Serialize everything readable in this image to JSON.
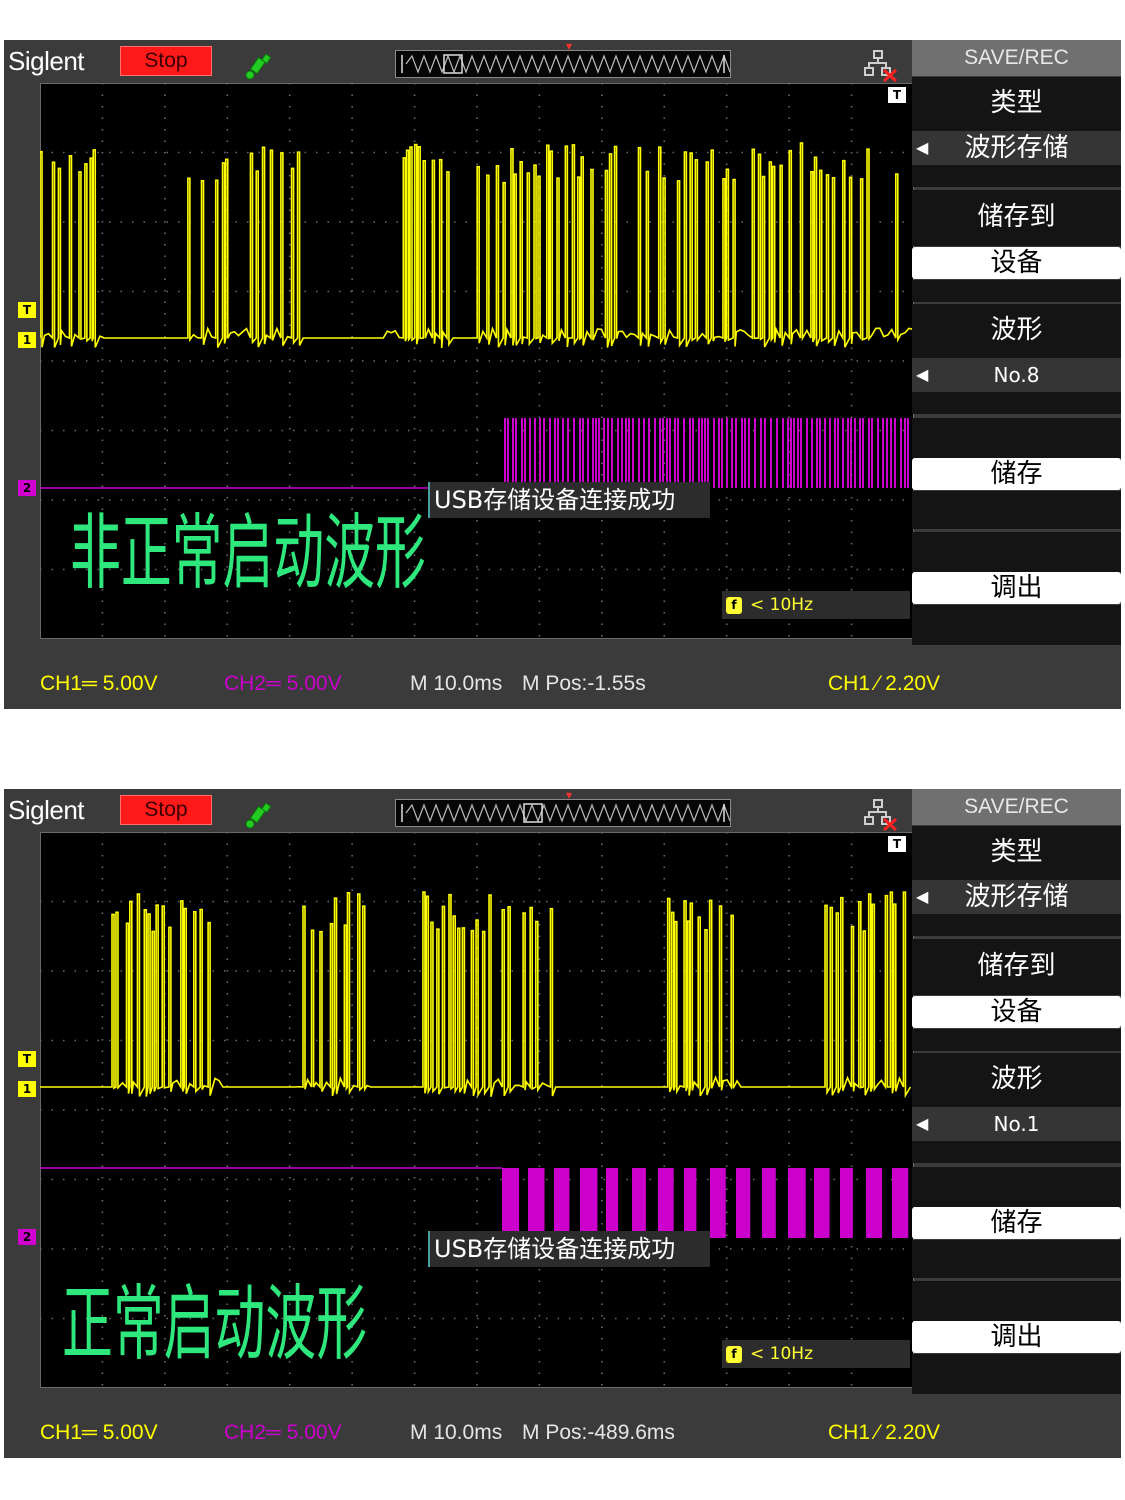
{
  "colors": {
    "ch1": "#ffff00",
    "ch2": "#cc00cc",
    "caption": "#2ee87e",
    "stop": "#ff1a1a"
  },
  "icons": [
    "usb-icon",
    "network-disconnected-icon",
    "trigger-marker-icon",
    "f-counter-icon"
  ],
  "screens": [
    {
      "brand": "Siglent",
      "run_state": "Stop",
      "trigger_mark": "T",
      "ch1_marker": "1",
      "ch2_marker": "2",
      "notice": "USB存储设备连接成功",
      "freq_badge": "f",
      "freq": "< 10Hz",
      "caption": "非正常启动波形",
      "status": {
        "ch1": "CH1═ 5.00V",
        "ch2": "CH2═ 5.00V",
        "timebase": "M 10.0ms",
        "mpos": "M Pos:-1.55s",
        "trigger": "CH1 ⁄ 2.20V"
      },
      "menu": {
        "title": "SAVE/REC",
        "type_label": "类型",
        "type_value": "波形存储",
        "save_to_label": "储存到",
        "save_to_value": "设备",
        "wave_label": "波形",
        "wave_value": "No.8",
        "save": "储存",
        "recall": "调出"
      }
    },
    {
      "brand": "Siglent",
      "run_state": "Stop",
      "trigger_mark": "T",
      "ch1_marker": "1",
      "ch2_marker": "2",
      "notice": "USB存储设备连接成功",
      "freq_badge": "f",
      "freq": "< 10Hz",
      "caption": "正常启动波形",
      "status": {
        "ch1": "CH1═ 5.00V",
        "ch2": "CH2═ 5.00V",
        "timebase": "M 10.0ms",
        "mpos": "M Pos:-489.6ms",
        "trigger": "CH1 ⁄ 2.20V"
      },
      "menu": {
        "title": "SAVE/REC",
        "type_label": "类型",
        "type_value": "波形存储",
        "save_to_label": "储存到",
        "save_to_value": "设备",
        "wave_label": "波形",
        "wave_value": "No.1",
        "save": "储存",
        "recall": "调出"
      }
    }
  ]
}
